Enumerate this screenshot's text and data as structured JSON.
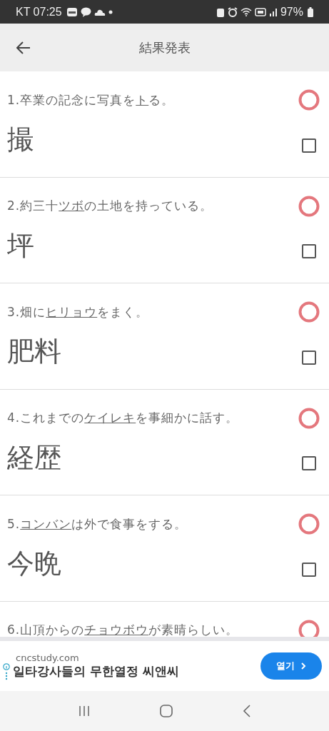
{
  "status_bar": {
    "carrier": "KT",
    "time": "07:25",
    "battery": "97%"
  },
  "app_bar": {
    "title": "結果発表"
  },
  "questions": [
    {
      "number": "1.",
      "before": "卒業の記念に写真を",
      "target": "ト",
      "after": "る。",
      "answer": "撮",
      "correct": true,
      "checked": false
    },
    {
      "number": "2.",
      "before": "約三十",
      "target": "ツボ",
      "after": "の土地を持っている。",
      "answer": "坪",
      "correct": true,
      "checked": false
    },
    {
      "number": "3.",
      "before": "畑に",
      "target": "ヒリョウ",
      "after": "をまく。",
      "answer": "肥料",
      "correct": true,
      "checked": false
    },
    {
      "number": "4.",
      "before": "これまでの",
      "target": "ケイレキ",
      "after": "を事細かに話す。",
      "answer": "経歴",
      "correct": true,
      "checked": false
    },
    {
      "number": "5.",
      "target": "コンバン",
      "after": "は外で食事をする。",
      "answer": "今晩",
      "correct": true,
      "checked": false
    },
    {
      "number": "6.",
      "before": "山頂からの",
      "target": "チョウボウ",
      "after": "が素晴らしい。",
      "correct": true
    }
  ],
  "ad": {
    "domain": "cncstudy.com",
    "headline": "일타강사들의 무한열정 씨앤씨",
    "button": "열기"
  }
}
